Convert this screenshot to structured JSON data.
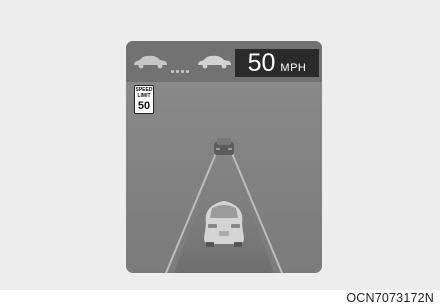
{
  "display": {
    "set_speed_value": "50",
    "set_speed_unit": "MPH",
    "speed_limit_line1": "SPEED",
    "speed_limit_line2": "LIMIT",
    "speed_limit_value": "50"
  },
  "icons": [
    "lead-car-icon",
    "following-distance-icon",
    "host-car-icon",
    "speed-limit-sign-icon",
    "rear-car-icon"
  ],
  "caption": "OCN7073172N"
}
